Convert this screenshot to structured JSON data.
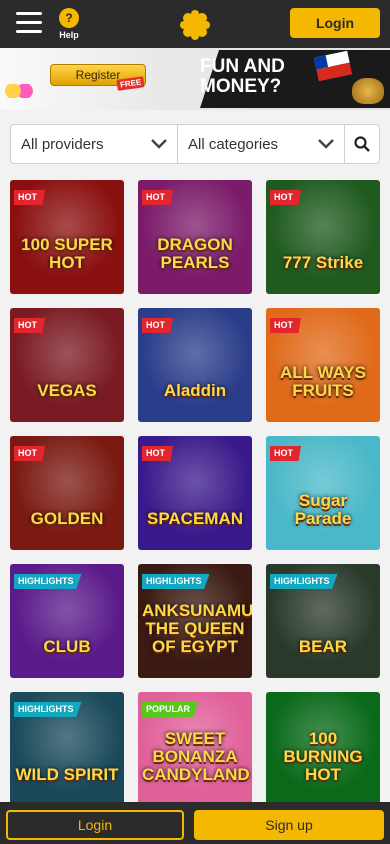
{
  "header": {
    "help_label": "Help",
    "login_label": "Login"
  },
  "banner": {
    "register_label": "Register",
    "free_label": "FREE",
    "line1": "FUN AND",
    "line2": "MONEY?"
  },
  "filters": {
    "providers": "All providers",
    "categories": "All categories"
  },
  "games": [
    {
      "badge": "HOT",
      "badge_type": "hot",
      "title": "100 SUPER HOT",
      "bg": "#8a0f0f"
    },
    {
      "badge": "HOT",
      "badge_type": "hot",
      "title": "DRAGON PEARLS",
      "bg": "#7b1b6a"
    },
    {
      "badge": "HOT",
      "badge_type": "hot",
      "title": "777 Strike",
      "bg": "#1f5a1f"
    },
    {
      "badge": "HOT",
      "badge_type": "hot",
      "title": "VEGAS",
      "bg": "#7a1a22"
    },
    {
      "badge": "HOT",
      "badge_type": "hot",
      "title": "Aladdin",
      "bg": "#2a3d8a"
    },
    {
      "badge": "HOT",
      "badge_type": "hot",
      "title": "ALL WAYS FRUITS",
      "bg": "#e06a1a"
    },
    {
      "badge": "HOT",
      "badge_type": "hot",
      "title": "GOLDEN",
      "bg": "#7a1a12"
    },
    {
      "badge": "HOT",
      "badge_type": "hot",
      "title": "SPACEMAN",
      "bg": "#3a1a8a"
    },
    {
      "badge": "HOT",
      "badge_type": "hot",
      "title": "Sugar Parade",
      "bg": "#4ab8c8"
    },
    {
      "badge": "HIGHLIGHTS",
      "badge_type": "highlights",
      "title": "CLUB",
      "bg": "#5a1a8a"
    },
    {
      "badge": "HIGHLIGHTS",
      "badge_type": "highlights",
      "title": "ANKSUNAMUN THE QUEEN OF EGYPT",
      "bg": "#3a1a12"
    },
    {
      "badge": "HIGHLIGHTS",
      "badge_type": "highlights",
      "title": "BEAR",
      "bg": "#2a3a2a"
    },
    {
      "badge": "HIGHLIGHTS",
      "badge_type": "highlights",
      "title": "WILD SPIRIT",
      "bg": "#1a4a5a"
    },
    {
      "badge": "POPULAR",
      "badge_type": "popular",
      "title": "SWEET BONANZA CANDYLAND",
      "bg": "#e0609a"
    },
    {
      "badge": "",
      "badge_type": "none",
      "title": "100 BURNING HOT",
      "bg": "#0a6a1a"
    }
  ],
  "footer": {
    "login_label": "Login",
    "signup_label": "Sign up"
  }
}
